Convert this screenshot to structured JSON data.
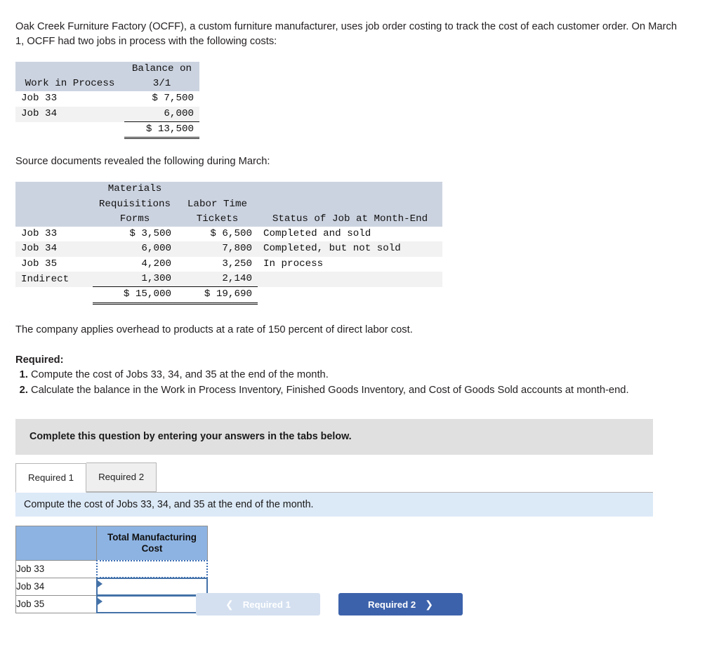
{
  "intro": {
    "paragraph1": "Oak Creek Furniture Factory (OCFF), a custom furniture manufacturer, uses job order costing to track the cost of each customer order. On March 1, OCFF had two jobs in process with the following costs:",
    "paragraph2": "Source documents revealed the following during March:",
    "paragraph3": "The company applies overhead to products at a rate of 150 percent of direct labor cost."
  },
  "wip_table": {
    "headers": {
      "col1_line1": "",
      "col1_line2": "Work in Process",
      "col2_line1": "Balance on",
      "col2_line2": "3/1"
    },
    "rows": [
      {
        "label": "Job 33",
        "balance": "$ 7,500"
      },
      {
        "label": "Job 34",
        "balance": "6,000"
      }
    ],
    "total": "$ 13,500"
  },
  "source_table": {
    "headers": {
      "col1": "",
      "col2_line1": "Materials",
      "col2_line2": "Requisitions",
      "col2_line3": "Forms",
      "col3_line1": "",
      "col3_line2": "Labor Time",
      "col3_line3": "Tickets",
      "col4_line1": "",
      "col4_line2": "",
      "col4_line3": "Status of Job at Month-End"
    },
    "rows": [
      {
        "label": "Job 33",
        "materials": "$ 3,500",
        "labor": "$ 6,500",
        "status": "Completed and sold"
      },
      {
        "label": "Job 34",
        "materials": "6,000",
        "labor": "7,800",
        "status": "Completed, but not sold"
      },
      {
        "label": "Job 35",
        "materials": "4,200",
        "labor": "3,250",
        "status": "In process"
      },
      {
        "label": "Indirect",
        "materials": "1,300",
        "labor": "2,140",
        "status": ""
      }
    ],
    "totals": {
      "label": "",
      "materials": "$ 15,000",
      "labor": "$ 19,690",
      "status": ""
    }
  },
  "required": {
    "heading": "Required:",
    "items": [
      "Compute the cost of Jobs 33, 34, and 35 at the end of the month.",
      "Calculate the balance in the Work in Process Inventory, Finished Goods Inventory, and Cost of Goods Sold accounts at month-end."
    ]
  },
  "grey_banner": {
    "text": "Complete this question by entering your answers in the tabs below."
  },
  "tabs": [
    {
      "label": "Required 1",
      "active": true
    },
    {
      "label": "Required 2",
      "active": false
    }
  ],
  "blue_banner": {
    "text": "Compute the cost of Jobs 33, 34, and 35 at the end of the month."
  },
  "answer_table": {
    "header_blank": "",
    "header_cost": "Total Manufacturing Cost",
    "rows": [
      {
        "label": "Job 33",
        "value": "",
        "selected": true
      },
      {
        "label": "Job 34",
        "value": "",
        "selected": false
      },
      {
        "label": "Job 35",
        "value": "",
        "selected": false
      }
    ]
  },
  "nav": {
    "prev_label": "Required 1",
    "prev_icon": "chevron-left-icon",
    "next_label": "Required 2",
    "next_icon": "chevron-right-icon"
  },
  "colors": {
    "table_header_bg": "#ccd3e0",
    "row_alt_bg": "#f2f2f2",
    "grey_banner_bg": "#e0e0e0",
    "blue_banner_bg": "#dce9f7",
    "answer_header_bg": "#8db3e2",
    "nav_next_bg": "#3c62ab",
    "nav_prev_bg": "#d4e0f0",
    "cell_border_blue": "#4472a8"
  }
}
